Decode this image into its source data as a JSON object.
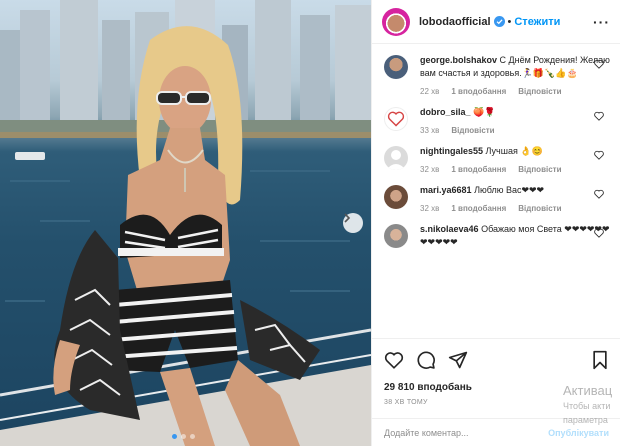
{
  "post": {
    "username": "lobodaofficial",
    "separator": "•",
    "follow_label": "Стежити",
    "more_label": "···",
    "likes_text": "29 810 вподобань",
    "time_text": "38 ХВ ТОМУ",
    "carousel": {
      "total": 3,
      "active": 0
    }
  },
  "comments": [
    {
      "username": "george.bolshakov",
      "text": "С Днём Рождения! Желаю вам счастья и здоровья.🏃‍♀️🎁🍾👍🎂",
      "time": "22 хв",
      "likes": "1 вподобання",
      "reply": "Відповісти"
    },
    {
      "username": "dobro_sila_",
      "text": "🍑🌹",
      "time": "33 хв",
      "likes": "",
      "reply": "Відповісти"
    },
    {
      "username": "nightingales55",
      "text": "Лучшая 👌😊",
      "time": "32 хв",
      "likes": "1 вподобання",
      "reply": "Відповісти"
    },
    {
      "username": "mari.ya6681",
      "text": "Люблю Вас❤❤❤",
      "time": "32 хв",
      "likes": "1 вподобання",
      "reply": "Відповісти"
    },
    {
      "username": "s.nikolaeva46",
      "text": "Обажаю моя Света ❤❤❤❤❤❤❤❤❤❤❤",
      "time": "32 хв",
      "likes": "1 вподобання",
      "reply": "Відповісти"
    }
  ],
  "add_comment": {
    "placeholder": "Додайте коментар...",
    "publish_label": "Опублікувати"
  },
  "watermark": {
    "line1": "Активац",
    "line2": "Чтобы акти",
    "line3": "параметра"
  },
  "colors": {
    "accent": "#0095f6",
    "publish_disabled": "#b2dffc",
    "muted": "#8e8e8e",
    "text": "#262626"
  },
  "icons": [
    "chevron-right-icon",
    "verified-icon",
    "more-icon",
    "heart-icon",
    "comment-icon",
    "share-icon",
    "bookmark-icon"
  ]
}
